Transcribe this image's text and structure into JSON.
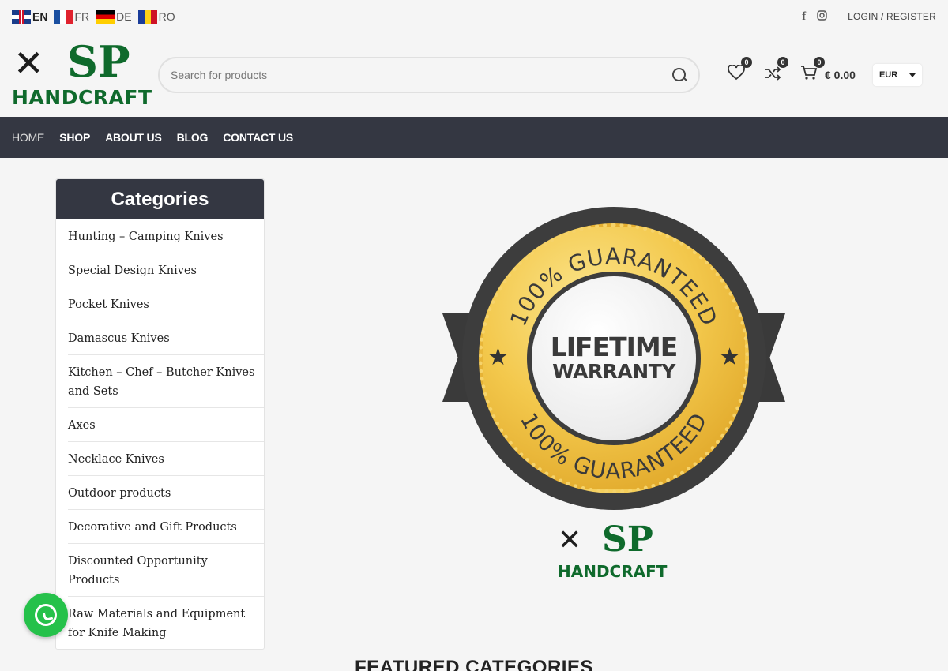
{
  "languages": [
    {
      "code": "EN",
      "flag": "uk-flag-icon",
      "active": true
    },
    {
      "code": "FR",
      "flag": "france-flag-icon"
    },
    {
      "code": "DE",
      "flag": "germany-flag-icon"
    },
    {
      "code": "RO",
      "flag": "romania-flag-icon"
    }
  ],
  "topbar": {
    "social": [
      "facebook-icon",
      "instagram-icon"
    ],
    "login_label": "LOGIN / REGISTER"
  },
  "brand": {
    "sp": "SP",
    "handcraft": "HANDCRAFT",
    "color": "#0f6a2c"
  },
  "search": {
    "placeholder": "Search for products"
  },
  "header": {
    "wishlist_count": "0",
    "compare_count": "0",
    "cart_count": "0",
    "cart_total": "€ 0.00",
    "currency": "EUR"
  },
  "nav": {
    "items": [
      "HOME",
      "SHOP",
      "ABOUT US",
      "BLOG",
      "CONTACT US"
    ],
    "bg": "#343742"
  },
  "categories": {
    "title": "Categories",
    "items": [
      "Hunting – Camping Knives",
      "Special Design Knives",
      "Pocket Knives",
      "Damascus Knives",
      "Kitchen – Chef – Butcher Knives and Sets",
      "Axes",
      "Necklace Knives",
      "Outdoor products",
      "Decorative and Gift Products",
      "Discounted Opportunity Products",
      "Raw Materials and Equipment for Knife Making"
    ]
  },
  "warranty": {
    "arc_top": "100% GUARANTEED",
    "arc_bottom": "100% GUARANTEED",
    "line1": "LIFETIME",
    "line2": "WARRANTY"
  },
  "featured_title": "FEATURED CATEGORIES",
  "whatsapp": {
    "icon": "whatsapp-icon",
    "color": "#25c14a"
  }
}
